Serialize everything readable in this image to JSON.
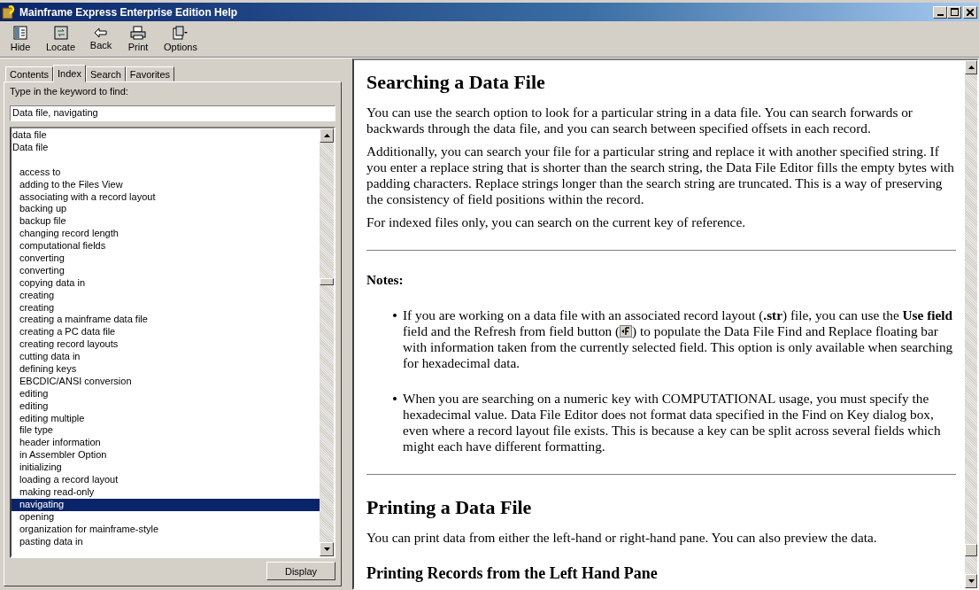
{
  "window": {
    "title": "Mainframe Express Enterprise Edition Help"
  },
  "toolbar": [
    {
      "kind": "hide",
      "label": "Hide"
    },
    {
      "kind": "locate",
      "label": "Locate"
    },
    {
      "kind": "back",
      "label": "Back"
    },
    {
      "kind": "print",
      "label": "Print"
    },
    {
      "kind": "options",
      "label": "Options"
    }
  ],
  "tabs": [
    {
      "label": "Contents",
      "selected": false
    },
    {
      "label": "Index",
      "selected": true
    },
    {
      "label": "Search",
      "selected": false
    },
    {
      "label": "Favorites",
      "selected": false
    }
  ],
  "keyword_label": "Type in the keyword to find:",
  "keyword_field": {
    "value": "Data file, navigating"
  },
  "index_list": [
    {
      "text": "data file",
      "selected": false
    },
    {
      "text": "Data file",
      "selected": false,
      "children": [
        {
          "text": "access to",
          "selected": false
        },
        {
          "text": "adding to the Files View",
          "selected": false
        },
        {
          "text": "associating with a record layout",
          "selected": false
        },
        {
          "text": "backing up",
          "selected": false
        },
        {
          "text": "backup file",
          "selected": false
        },
        {
          "text": "changing record length",
          "selected": false
        },
        {
          "text": "computational fields",
          "selected": false
        },
        {
          "text": "converting",
          "selected": false
        },
        {
          "text": "converting",
          "selected": false
        },
        {
          "text": "copying data in",
          "selected": false
        },
        {
          "text": "creating",
          "selected": false
        },
        {
          "text": "creating",
          "selected": false
        },
        {
          "text": "creating a mainframe data file",
          "selected": false
        },
        {
          "text": "creating a PC data file",
          "selected": false
        },
        {
          "text": "creating record layouts",
          "selected": false
        },
        {
          "text": "cutting data in",
          "selected": false
        },
        {
          "text": "defining keys",
          "selected": false
        },
        {
          "text": "EBCDIC/ANSI conversion",
          "selected": false
        },
        {
          "text": "editing",
          "selected": false
        },
        {
          "text": "editing",
          "selected": false
        },
        {
          "text": "editing multiple",
          "selected": false
        },
        {
          "text": "file type",
          "selected": false
        },
        {
          "text": "header information",
          "selected": false
        },
        {
          "text": "in Assembler Option",
          "selected": false
        },
        {
          "text": "initializing",
          "selected": false
        },
        {
          "text": "loading a record layout",
          "selected": false
        },
        {
          "text": "making read-only",
          "selected": false
        },
        {
          "text": "navigating",
          "selected": true
        },
        {
          "text": "opening",
          "selected": false
        },
        {
          "text": "organization for mainframe-style",
          "selected": false
        },
        {
          "text": "pasting data in",
          "selected": false
        }
      ]
    }
  ],
  "display_button": "Display",
  "content": [
    {
      "kind": "h1",
      "text": "Searching a Data File"
    },
    {
      "kind": "p",
      "text": "You can use the search option to look for a particular string in a data file. You can search forwards or backwards through the data file, and you can search between specified offsets in each record."
    },
    {
      "kind": "p",
      "text": "Additionally, you can search your file for a particular string and replace it with another specified string. If you enter a replace string that is shorter than the search string, the Data File Editor fills the empty bytes with padding characters. Replace strings longer than the search string are truncated. This is a way of preserving the consistency of field positions within the record."
    },
    {
      "kind": "p",
      "text": "For indexed files only, you can search on the current key of reference."
    },
    {
      "kind": "hr"
    },
    {
      "kind": "notes",
      "text": "Notes:"
    },
    {
      "kind": "bullet",
      "text": "If you are working on a data file with an associated record layout (**.str**) file, you can use the **Use field** field and the Refresh from field button (",
      "after": ") to populate the Data File Find and Replace floating bar with information taken from the currently selected field. This option is only available when searching for hexadecimal data."
    },
    {
      "kind": "bullet",
      "text": "When you are searching on a numeric key with COMPUTATIONAL usage, you must specify the hexadecimal value. Data File Editor does not format data specified in the Find on Key dialog box, even where a record layout file exists. This is because a key can be split across several fields which might each have different formatting."
    },
    {
      "kind": "hr"
    },
    {
      "kind": "h1",
      "text": "Printing a Data File"
    },
    {
      "kind": "p",
      "text": "You can print data from either the left-hand or right-hand pane. You can also preview the data."
    },
    {
      "kind": "h2",
      "text": "Printing Records from the Left Hand Pane"
    }
  ]
}
